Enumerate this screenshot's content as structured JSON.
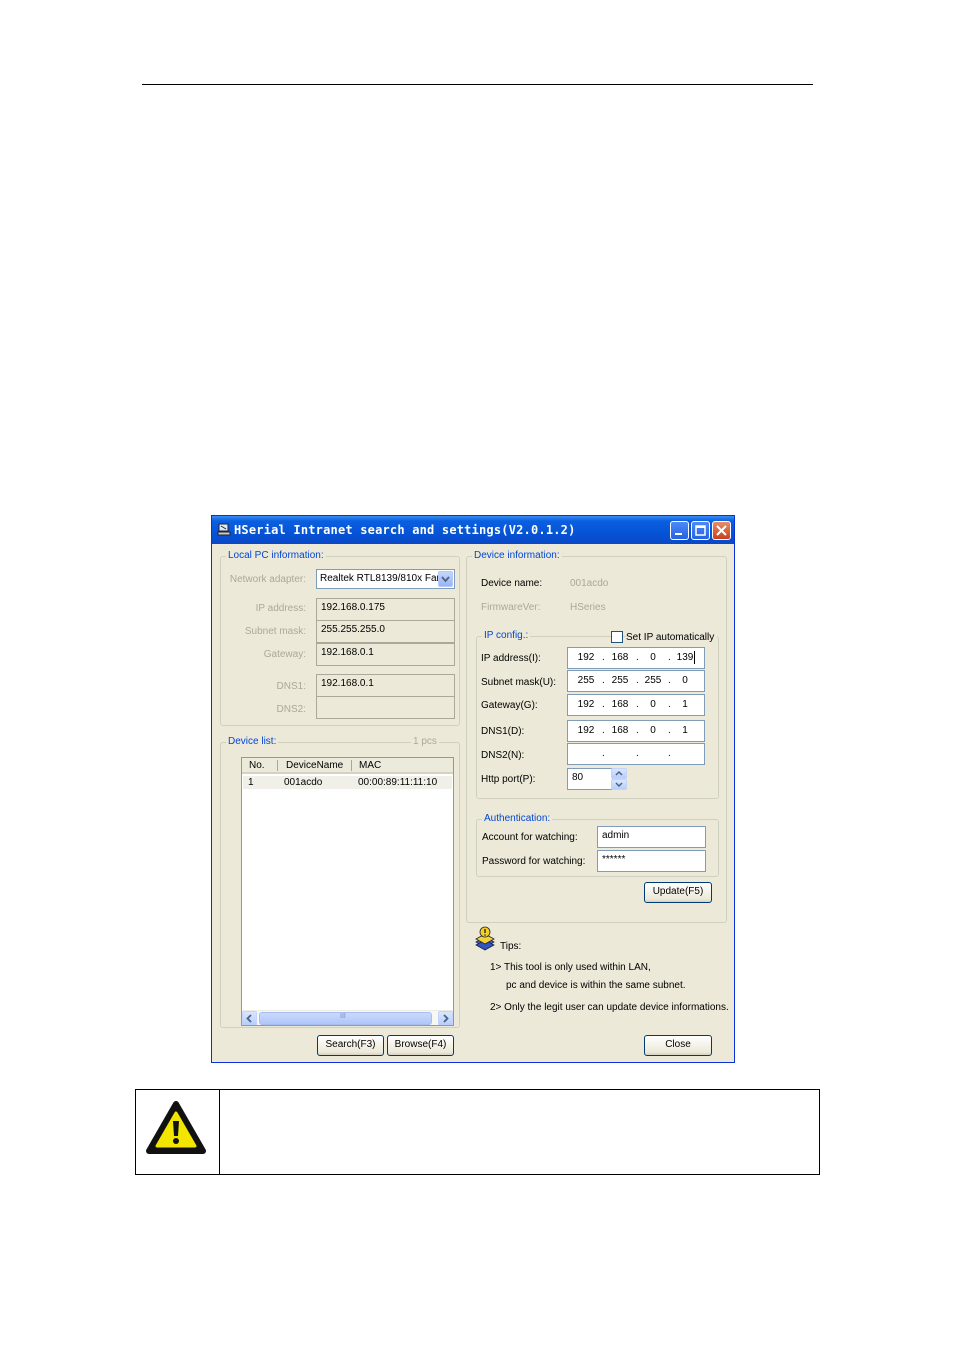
{
  "window": {
    "title": "HSerial Intranet search and settings(V2.0.1.2)"
  },
  "local_pc": {
    "legend": "Local PC information:",
    "network_adapter_label": "Network adapter:",
    "network_adapter_value": "Realtek RTL8139/810x Far",
    "ip_address_label": "IP address:",
    "ip_address_value": "192.168.0.175",
    "subnet_mask_label": "Subnet mask:",
    "subnet_mask_value": "255.255.255.0",
    "gateway_label": "Gateway:",
    "gateway_value": "192.168.0.1",
    "dns1_label": "DNS1:",
    "dns1_value": "192.168.0.1",
    "dns2_label": "DNS2:",
    "dns2_value": ""
  },
  "device_list": {
    "legend": "Device list:",
    "count": "1 pcs",
    "columns": [
      "No.",
      "DeviceName",
      "MAC"
    ],
    "rows": [
      {
        "no": "1",
        "name": "001acdo",
        "mac": "00:00:89:11:11:10"
      }
    ],
    "scroll_thumb_glyph": "III"
  },
  "device_info": {
    "legend": "Device information:",
    "device_name_label": "Device name:",
    "device_name_value": "001acdo",
    "firmware_label": "FirmwareVer:",
    "firmware_value": "HSeries"
  },
  "ip_config": {
    "legend": "IP config.:",
    "auto_label": "Set IP automatically",
    "ip_address_label": "IP address(I):",
    "ip_address": [
      "192",
      "168",
      "0",
      "139"
    ],
    "subnet_mask_label": "Subnet mask(U):",
    "subnet_mask": [
      "255",
      "255",
      "255",
      "0"
    ],
    "gateway_label": "Gateway(G):",
    "gateway": [
      "192",
      "168",
      "0",
      "1"
    ],
    "dns1_label": "DNS1(D):",
    "dns1": [
      "192",
      "168",
      "0",
      "1"
    ],
    "dns2_label": "DNS2(N):",
    "dns2": [
      "",
      "",
      "",
      ""
    ],
    "http_port_label": "Http port(P):",
    "http_port_value": "80"
  },
  "auth": {
    "legend": "Authentication:",
    "account_label": "Account for watching:",
    "account_value": "admin",
    "password_label": "Password for watching:",
    "password_value": "******"
  },
  "buttons": {
    "update": "Update(F5)",
    "search": "Search(F3)",
    "browse": "Browse(F4)",
    "close": "Close"
  },
  "tips": {
    "title": "Tips:",
    "line1": "1> This tool is only used within LAN,",
    "line2": "pc and device is within the same subnet.",
    "line3": "2> Only the legit user can update  device informations."
  },
  "colors": {
    "titlebar": "#0554d6",
    "legend_text": "#0046d5",
    "dialog_bg": "#ece9d8",
    "warning_yellow": "#f2e600"
  }
}
